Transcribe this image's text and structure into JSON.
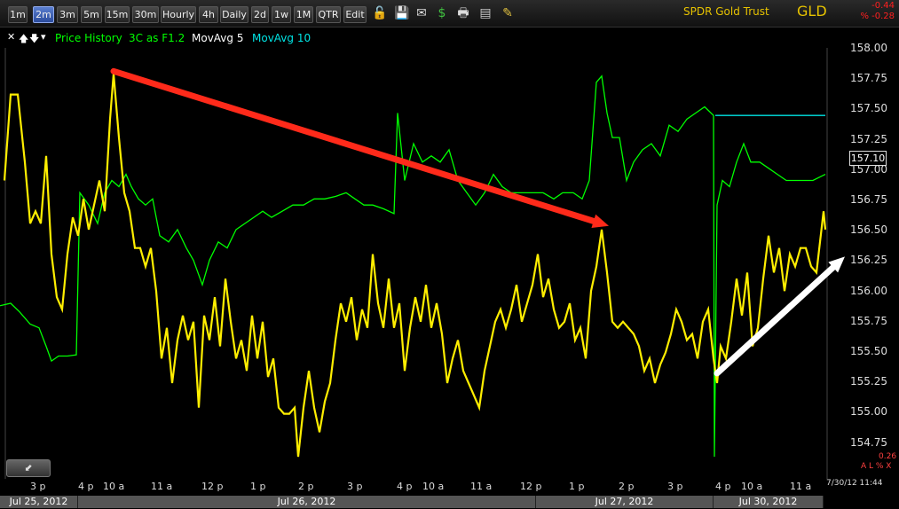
{
  "toolbar": {
    "timeframes": [
      {
        "label": "1m",
        "active": false
      },
      {
        "label": "2m",
        "active": true
      },
      {
        "label": "3m",
        "active": false
      },
      {
        "label": "5m",
        "active": false
      },
      {
        "label": "15m",
        "active": false
      },
      {
        "label": "30m",
        "active": false
      },
      {
        "label": "Hourly",
        "active": false
      },
      {
        "label": "4h",
        "active": false
      },
      {
        "label": "Daily",
        "active": false
      },
      {
        "label": "2d",
        "active": false
      },
      {
        "label": "1w",
        "active": false
      },
      {
        "label": "1M",
        "active": false
      },
      {
        "label": "QTR",
        "active": false
      },
      {
        "label": "Edit",
        "active": false
      }
    ],
    "icons": [
      {
        "name": "lock-icon",
        "glyph": "🔓"
      },
      {
        "name": "save-icon",
        "glyph": "💾"
      },
      {
        "name": "email-icon",
        "glyph": "✉"
      },
      {
        "name": "dollar-icon",
        "glyph": "$"
      },
      {
        "name": "print-icon",
        "glyph": "🖶"
      },
      {
        "name": "calculator-icon",
        "glyph": "▤"
      },
      {
        "name": "pencil-icon",
        "glyph": "✎"
      }
    ]
  },
  "symbol": {
    "name": "SPDR Gold Trust",
    "ticker": "GLD",
    "net_change": "-0.44",
    "pct_change": "% -0.28"
  },
  "legend": {
    "items": [
      {
        "label": "Price History",
        "color": "#00ff00"
      },
      {
        "label": "3C as F1.2",
        "color": "#00ff00"
      },
      {
        "label": "MovAvg 5",
        "color": "#ffffff"
      },
      {
        "label": "MovAvg 10",
        "color": "#00e5e5"
      }
    ]
  },
  "price_axis": {
    "ticks": [
      "158.00",
      "157.75",
      "157.50",
      "157.25",
      "157.00",
      "156.75",
      "156.50",
      "156.25",
      "156.00",
      "155.75",
      "155.50",
      "155.25",
      "155.00",
      "154.75"
    ],
    "last_price": "157.10"
  },
  "indicator": {
    "right_value": "0.26",
    "flags": "A L % X"
  },
  "time_axis": {
    "ticks": [
      "3 p",
      "4 p",
      "10 a",
      "11 a",
      "12 p",
      "1 p",
      "2 p",
      "3 p",
      "4 p",
      "10 a",
      "11 a",
      "12 p",
      "1 p",
      "2 p",
      "3 p",
      "4 p",
      "10 a",
      "11 a"
    ],
    "timestamp": "7/30/12 11:44",
    "dates": [
      "Jul 25, 2012",
      "Jul 26, 2012",
      "Jul 27, 2012",
      "Jul 30, 2012"
    ]
  },
  "colors": {
    "price": "#00ff00",
    "indicator": "#ffee00",
    "ma10": "#00e5e5",
    "arrow_down": "#ff2a1a",
    "arrow_up": "#ffffff"
  },
  "chart_data": {
    "type": "line",
    "ylim": [
      154.62,
      158.13
    ],
    "series": [
      {
        "name": "Price History",
        "color": "#00ff00",
        "points": [
          [
            0,
            156.03
          ],
          [
            12,
            156.05
          ],
          [
            22,
            155.98
          ],
          [
            34,
            155.88
          ],
          [
            44,
            155.85
          ],
          [
            52,
            155.7
          ],
          [
            58,
            155.58
          ],
          [
            66,
            155.62
          ],
          [
            76,
            155.62
          ],
          [
            86,
            155.63
          ],
          [
            90,
            156.95
          ],
          [
            100,
            156.85
          ],
          [
            110,
            156.7
          ],
          [
            118,
            156.95
          ],
          [
            126,
            157.05
          ],
          [
            134,
            157.0
          ],
          [
            142,
            157.1
          ],
          [
            148,
            157.0
          ],
          [
            156,
            156.9
          ],
          [
            164,
            156.85
          ],
          [
            172,
            156.9
          ],
          [
            180,
            156.6
          ],
          [
            190,
            156.55
          ],
          [
            200,
            156.65
          ],
          [
            210,
            156.5
          ],
          [
            218,
            156.4
          ],
          [
            228,
            156.2
          ],
          [
            236,
            156.4
          ],
          [
            246,
            156.55
          ],
          [
            256,
            156.5
          ],
          [
            266,
            156.65
          ],
          [
            276,
            156.7
          ],
          [
            286,
            156.75
          ],
          [
            296,
            156.8
          ],
          [
            306,
            156.75
          ],
          [
            318,
            156.8
          ],
          [
            330,
            156.85
          ],
          [
            342,
            156.85
          ],
          [
            354,
            156.9
          ],
          [
            366,
            156.9
          ],
          [
            378,
            156.92
          ],
          [
            390,
            156.95
          ],
          [
            400,
            156.9
          ],
          [
            410,
            156.85
          ],
          [
            420,
            156.85
          ],
          [
            432,
            156.82
          ],
          [
            444,
            156.78
          ],
          [
            448,
            157.6
          ],
          [
            456,
            157.05
          ],
          [
            466,
            157.35
          ],
          [
            476,
            157.2
          ],
          [
            486,
            157.25
          ],
          [
            496,
            157.2
          ],
          [
            506,
            157.3
          ],
          [
            516,
            157.05
          ],
          [
            526,
            156.95
          ],
          [
            536,
            156.85
          ],
          [
            546,
            156.95
          ],
          [
            556,
            157.1
          ],
          [
            566,
            157.0
          ],
          [
            576,
            156.95
          ],
          [
            588,
            156.95
          ],
          [
            600,
            156.95
          ],
          [
            612,
            156.95
          ],
          [
            624,
            156.9
          ],
          [
            634,
            156.95
          ],
          [
            646,
            156.95
          ],
          [
            656,
            156.9
          ],
          [
            664,
            157.05
          ],
          [
            668,
            157.45
          ],
          [
            672,
            157.85
          ],
          [
            678,
            157.9
          ],
          [
            684,
            157.6
          ],
          [
            690,
            157.4
          ],
          [
            698,
            157.4
          ],
          [
            706,
            157.05
          ],
          [
            714,
            157.2
          ],
          [
            724,
            157.3
          ],
          [
            734,
            157.35
          ],
          [
            744,
            157.25
          ],
          [
            754,
            157.5
          ],
          [
            764,
            157.45
          ],
          [
            774,
            157.55
          ],
          [
            784,
            157.6
          ],
          [
            794,
            157.65
          ],
          [
            804,
            157.58
          ],
          [
            805,
            154.8
          ],
          [
            808,
            156.85
          ],
          [
            814,
            157.05
          ],
          [
            822,
            157.0
          ],
          [
            830,
            157.2
          ],
          [
            838,
            157.35
          ],
          [
            846,
            157.2
          ],
          [
            856,
            157.2
          ],
          [
            866,
            157.15
          ],
          [
            876,
            157.1
          ],
          [
            886,
            157.05
          ],
          [
            896,
            157.05
          ],
          [
            906,
            157.05
          ],
          [
            916,
            157.05
          ],
          [
            930,
            157.1
          ]
        ]
      },
      {
        "name": "3C as F1.2",
        "color": "#ffee00",
        "points": [
          [
            5,
            157.05
          ],
          [
            12,
            157.75
          ],
          [
            20,
            157.75
          ],
          [
            28,
            157.2
          ],
          [
            34,
            156.7
          ],
          [
            40,
            156.8
          ],
          [
            46,
            156.7
          ],
          [
            52,
            157.25
          ],
          [
            58,
            156.45
          ],
          [
            64,
            156.1
          ],
          [
            70,
            156.0
          ],
          [
            76,
            156.45
          ],
          [
            82,
            156.75
          ],
          [
            88,
            156.6
          ],
          [
            94,
            156.9
          ],
          [
            100,
            156.65
          ],
          [
            106,
            156.85
          ],
          [
            112,
            157.05
          ],
          [
            118,
            156.8
          ],
          [
            124,
            157.55
          ],
          [
            128,
            157.92
          ],
          [
            134,
            157.4
          ],
          [
            140,
            156.95
          ],
          [
            146,
            156.8
          ],
          [
            152,
            156.5
          ],
          [
            158,
            156.5
          ],
          [
            164,
            156.35
          ],
          [
            170,
            156.5
          ],
          [
            176,
            156.15
          ],
          [
            182,
            155.6
          ],
          [
            188,
            155.85
          ],
          [
            194,
            155.4
          ],
          [
            200,
            155.75
          ],
          [
            206,
            155.95
          ],
          [
            212,
            155.75
          ],
          [
            218,
            155.9
          ],
          [
            224,
            155.2
          ],
          [
            230,
            155.95
          ],
          [
            236,
            155.75
          ],
          [
            242,
            156.1
          ],
          [
            248,
            155.7
          ],
          [
            254,
            156.25
          ],
          [
            260,
            155.9
          ],
          [
            266,
            155.6
          ],
          [
            272,
            155.75
          ],
          [
            278,
            155.5
          ],
          [
            284,
            155.95
          ],
          [
            290,
            155.6
          ],
          [
            296,
            155.9
          ],
          [
            302,
            155.45
          ],
          [
            308,
            155.6
          ],
          [
            314,
            155.2
          ],
          [
            320,
            155.15
          ],
          [
            326,
            155.15
          ],
          [
            332,
            155.2
          ],
          [
            336,
            154.8
          ],
          [
            342,
            155.2
          ],
          [
            348,
            155.5
          ],
          [
            354,
            155.2
          ],
          [
            360,
            155.0
          ],
          [
            366,
            155.25
          ],
          [
            372,
            155.4
          ],
          [
            378,
            155.75
          ],
          [
            384,
            156.05
          ],
          [
            390,
            155.9
          ],
          [
            396,
            156.1
          ],
          [
            402,
            155.75
          ],
          [
            408,
            156.0
          ],
          [
            414,
            155.85
          ],
          [
            420,
            156.45
          ],
          [
            426,
            156.05
          ],
          [
            432,
            155.85
          ],
          [
            438,
            156.25
          ],
          [
            444,
            155.85
          ],
          [
            450,
            156.05
          ],
          [
            456,
            155.5
          ],
          [
            462,
            155.85
          ],
          [
            468,
            156.1
          ],
          [
            474,
            155.9
          ],
          [
            480,
            156.2
          ],
          [
            486,
            155.85
          ],
          [
            492,
            156.05
          ],
          [
            498,
            155.8
          ],
          [
            504,
            155.4
          ],
          [
            510,
            155.6
          ],
          [
            516,
            155.75
          ],
          [
            522,
            155.5
          ],
          [
            528,
            155.4
          ],
          [
            534,
            155.3
          ],
          [
            540,
            155.2
          ],
          [
            546,
            155.5
          ],
          [
            552,
            155.7
          ],
          [
            558,
            155.9
          ],
          [
            564,
            156.0
          ],
          [
            570,
            155.85
          ],
          [
            576,
            156.0
          ],
          [
            582,
            156.2
          ],
          [
            588,
            155.9
          ],
          [
            594,
            156.05
          ],
          [
            600,
            156.2
          ],
          [
            606,
            156.45
          ],
          [
            612,
            156.1
          ],
          [
            618,
            156.25
          ],
          [
            624,
            156.0
          ],
          [
            630,
            155.85
          ],
          [
            636,
            155.9
          ],
          [
            642,
            156.05
          ],
          [
            648,
            155.75
          ],
          [
            654,
            155.85
          ],
          [
            660,
            155.6
          ],
          [
            666,
            156.15
          ],
          [
            672,
            156.35
          ],
          [
            678,
            156.65
          ],
          [
            684,
            156.3
          ],
          [
            690,
            155.9
          ],
          [
            696,
            155.85
          ],
          [
            702,
            155.9
          ],
          [
            708,
            155.85
          ],
          [
            714,
            155.8
          ],
          [
            720,
            155.7
          ],
          [
            726,
            155.5
          ],
          [
            732,
            155.6
          ],
          [
            738,
            155.4
          ],
          [
            744,
            155.55
          ],
          [
            750,
            155.65
          ],
          [
            756,
            155.8
          ],
          [
            762,
            156.0
          ],
          [
            768,
            155.9
          ],
          [
            774,
            155.75
          ],
          [
            780,
            155.8
          ],
          [
            786,
            155.6
          ],
          [
            792,
            155.9
          ],
          [
            798,
            156.0
          ],
          [
            804,
            155.6
          ],
          [
            808,
            155.4
          ],
          [
            812,
            155.7
          ],
          [
            818,
            155.6
          ],
          [
            824,
            155.9
          ],
          [
            830,
            156.25
          ],
          [
            836,
            155.95
          ],
          [
            842,
            156.3
          ],
          [
            848,
            155.7
          ],
          [
            854,
            155.85
          ],
          [
            860,
            156.25
          ],
          [
            866,
            156.6
          ],
          [
            872,
            156.3
          ],
          [
            878,
            156.5
          ],
          [
            884,
            156.15
          ],
          [
            890,
            156.45
          ],
          [
            896,
            156.35
          ],
          [
            902,
            156.5
          ],
          [
            908,
            156.5
          ],
          [
            914,
            156.35
          ],
          [
            920,
            156.3
          ],
          [
            924,
            156.55
          ],
          [
            928,
            156.8
          ],
          [
            930,
            156.65
          ]
        ]
      },
      {
        "name": "MovAvg 10",
        "color": "#00e5e5",
        "points": [
          [
            806,
            157.58
          ],
          [
            930,
            157.58
          ]
        ]
      }
    ],
    "annotations": [
      {
        "type": "arrow",
        "color": "#ff2a1a",
        "from": [
          128,
          157.94
        ],
        "to": [
          686,
          156.68
        ]
      },
      {
        "type": "arrow",
        "color": "#ffffff",
        "from": [
          808,
          155.48
        ],
        "to": [
          952,
          156.43
        ]
      }
    ]
  }
}
